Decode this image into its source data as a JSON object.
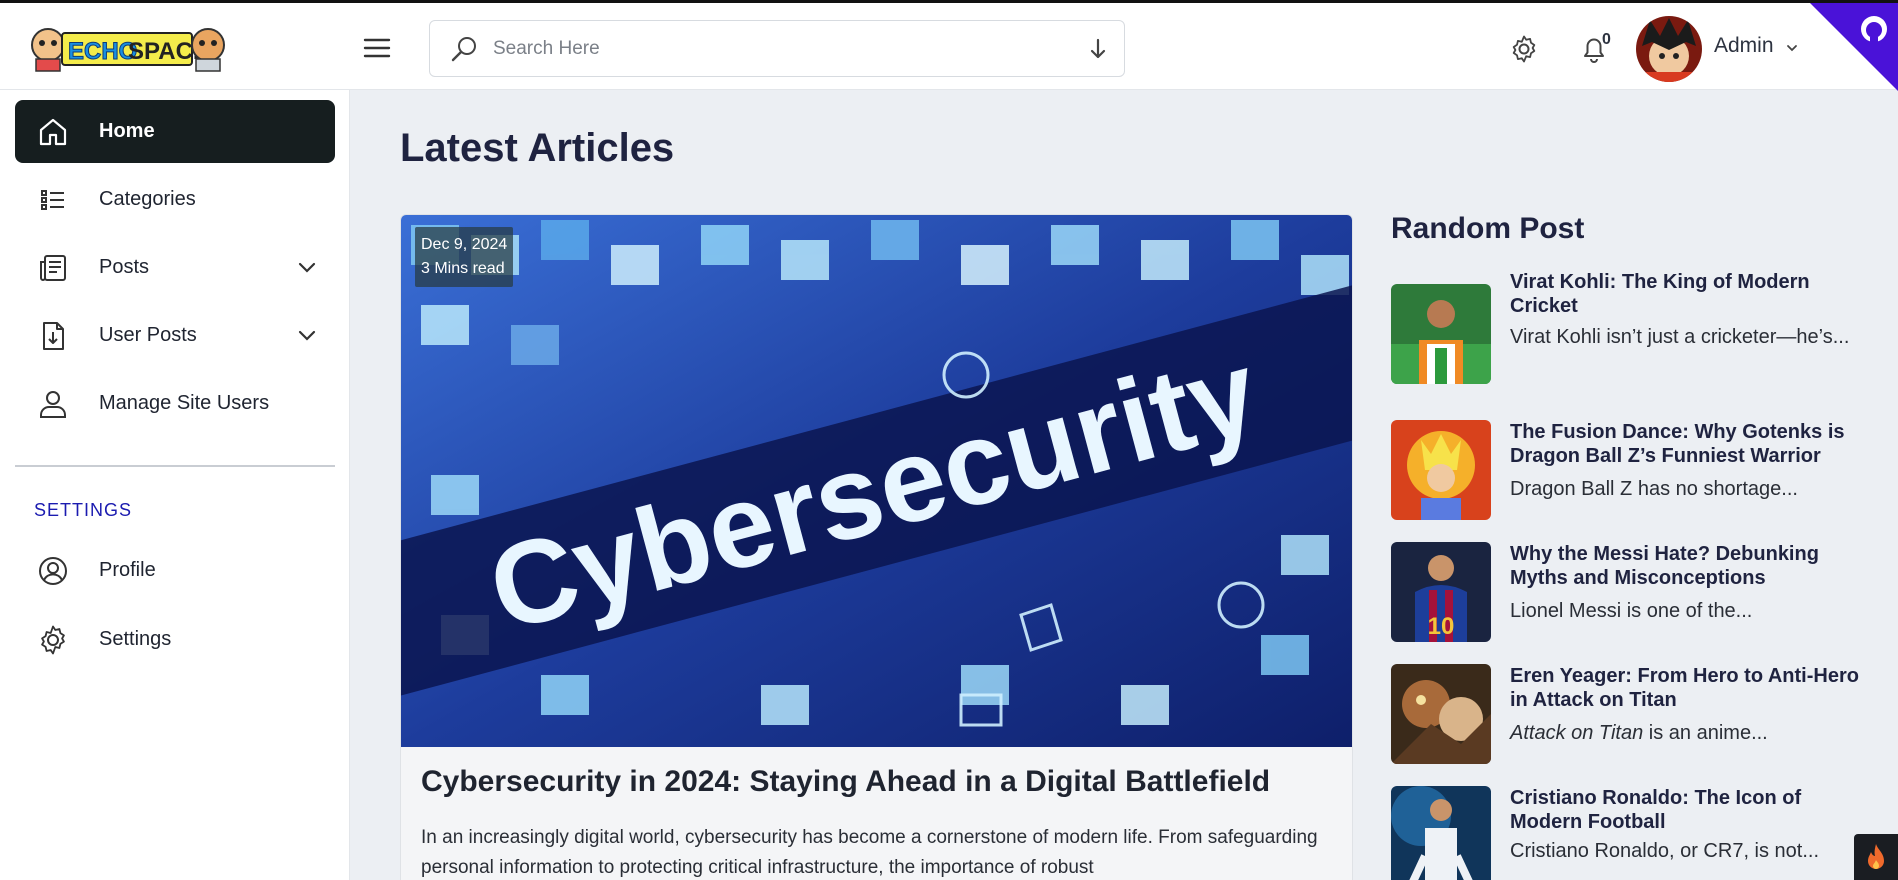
{
  "header": {
    "logo_text": "ECHOSPACE",
    "search_placeholder": "Search Here",
    "notification_count": "0",
    "user_name": "Admin"
  },
  "sidebar": {
    "items": [
      {
        "label": "Home",
        "icon": "home-icon",
        "active": true
      },
      {
        "label": "Categories",
        "icon": "list-icon"
      },
      {
        "label": "Posts",
        "icon": "document-icon",
        "expandable": true
      },
      {
        "label": "User Posts",
        "icon": "file-download-icon",
        "expandable": true
      },
      {
        "label": "Manage Site Users",
        "icon": "user-icon"
      }
    ],
    "settings_heading": "SETTINGS",
    "settings_items": [
      {
        "label": "Profile",
        "icon": "user-circle-icon"
      },
      {
        "label": "Settings",
        "icon": "gear-icon"
      }
    ]
  },
  "main": {
    "title": "Latest Articles",
    "featured": {
      "date": "Dec 9, 2024",
      "read_time": "3 Mins read",
      "image_text": "Cybersecurity",
      "title": "Cybersecurity in 2024: Staying Ahead in a Digital Battlefield",
      "excerpt": "In an increasingly digital world, cybersecurity has become a cornerstone of modern life. From safeguarding personal information to protecting critical infrastructure, the importance of robust"
    }
  },
  "random_posts": {
    "heading": "Random Post",
    "items": [
      {
        "title": "Virat Kohli: The King of Modern Cricket",
        "excerpt": "Virat Kohli isn’t just a cricketer—he’s..."
      },
      {
        "title": "The Fusion Dance: Why Gotenks is Dragon Ball Z’s Funniest Warrior",
        "excerpt": "Dragon Ball Z has no shortage..."
      },
      {
        "title": "Why the Messi Hate? Debunking Myths and Misconceptions",
        "excerpt": "Lionel Messi is one of the..."
      },
      {
        "title": "Eren Yeager: From Hero to Anti-Hero in Attack on Titan",
        "excerpt_italic": "Attack on Titan",
        "excerpt_rest": " is an anime..."
      },
      {
        "title": "Cristiano Ronaldo: The Icon of Modern Football",
        "excerpt": "Cristiano Ronaldo, or CR7, is not..."
      }
    ]
  },
  "colors": {
    "active_nav_bg": "#161e1f",
    "settings_heading": "#1b1bb0",
    "corner_ribbon": "#4a12d8"
  }
}
